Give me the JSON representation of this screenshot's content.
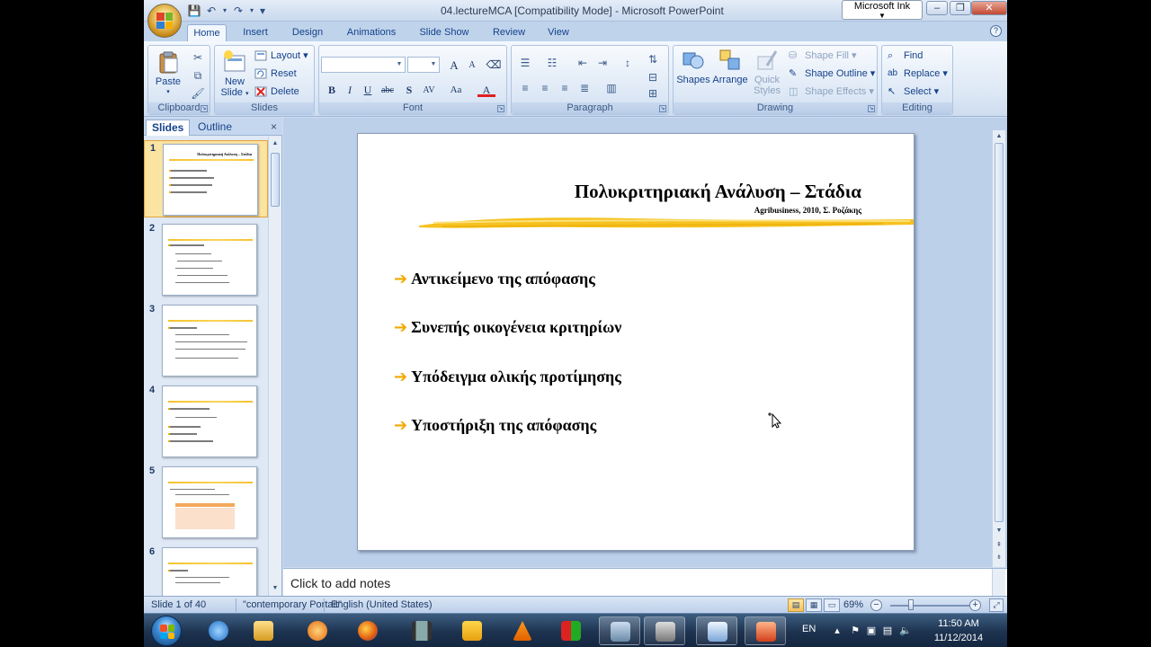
{
  "window": {
    "title": "04.lectureMCA [Compatibility Mode] - Microsoft PowerPoint",
    "ink_label": "Microsoft Ink",
    "minimize": "–",
    "restore": "❐",
    "close": "✕"
  },
  "qat": {
    "save": "💾",
    "undo": "↶",
    "redo": "↷",
    "customize": "▾"
  },
  "tabs": [
    {
      "label": "Home",
      "active": true
    },
    {
      "label": "Insert"
    },
    {
      "label": "Design"
    },
    {
      "label": "Animations"
    },
    {
      "label": "Slide Show"
    },
    {
      "label": "Review"
    },
    {
      "label": "View"
    }
  ],
  "ribbon": {
    "clipboard": {
      "label": "Clipboard",
      "paste": "Paste"
    },
    "slides": {
      "label": "Slides",
      "new_slide": "New Slide",
      "layout": "Layout",
      "reset": "Reset",
      "delete": "Delete"
    },
    "font": {
      "label": "Font",
      "grow": "A",
      "shrink": "A",
      "bold": "B",
      "italic": "I",
      "underline": "U",
      "strike": "abc",
      "shadow": "S",
      "spacing": "AV",
      "case": "Aa",
      "color": "A"
    },
    "paragraph": {
      "label": "Paragraph"
    },
    "drawing": {
      "label": "Drawing",
      "shapes": "Shapes",
      "arrange": "Arrange",
      "quick_styles": "Quick Styles",
      "shape_fill": "Shape Fill",
      "shape_outline": "Shape Outline",
      "shape_effects": "Shape Effects"
    },
    "editing": {
      "label": "Editing",
      "find": "Find",
      "replace": "Replace",
      "select": "Select"
    }
  },
  "panel": {
    "tab_slides": "Slides",
    "tab_outline": "Outline",
    "close": "×",
    "thumbnails": [
      {
        "num": "1",
        "selected": true
      },
      {
        "num": "2"
      },
      {
        "num": "3"
      },
      {
        "num": "4"
      },
      {
        "num": "5"
      },
      {
        "num": "6"
      }
    ]
  },
  "slide": {
    "title": "Πολυκριτηριακή Ανάλυση – Στάδια",
    "subtitle": "Agribusiness, 2010, Σ. Ροζάκης",
    "bullet_arrow": "➔",
    "bullets": [
      "Αντικείμενο της απόφασης",
      "Συνεπής οικογένεια κριτηρίων",
      "Υπόδειγμα ολικής προτίμησης",
      "Υποστήριξη της απόφασης"
    ],
    "accent_color": "#f2a900"
  },
  "notes": {
    "placeholder": "Click to add notes"
  },
  "status": {
    "slide_info": "Slide 1 of 40",
    "theme": "\"contemporary Portait\"",
    "language": "English (United States)",
    "zoom": "69%"
  },
  "taskbar": {
    "lang": "EN",
    "time": "11:50 AM",
    "date": "11/12/2014"
  }
}
